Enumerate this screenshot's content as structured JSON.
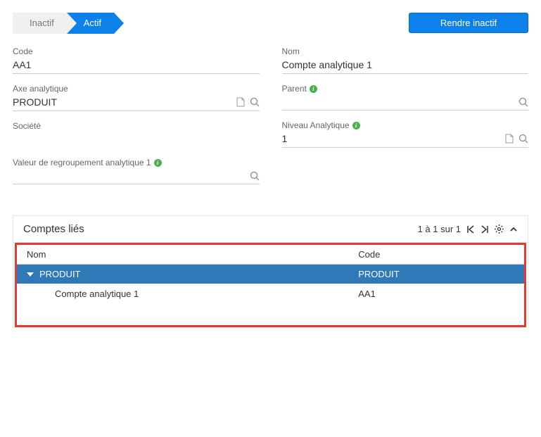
{
  "status": {
    "inactive": "Inactif",
    "active": "Actif"
  },
  "actions": {
    "make_inactive": "Rendre inactif"
  },
  "fields": {
    "code": {
      "label": "Code",
      "value": "AA1"
    },
    "nom": {
      "label": "Nom",
      "value": "Compte analytique 1"
    },
    "axe": {
      "label": "Axe analytique",
      "value": "PRODUIT"
    },
    "parent": {
      "label": "Parent",
      "value": ""
    },
    "societe": {
      "label": "Société",
      "value": ""
    },
    "niveau": {
      "label": "Niveau Analytique",
      "value": "1"
    },
    "regroup": {
      "label": "Valeur de regroupement analytique 1",
      "value": ""
    }
  },
  "panel": {
    "title": "Comptes liés",
    "pager": "1 à 1 sur 1",
    "columns": {
      "nom": "Nom",
      "code": "Code"
    },
    "group": {
      "nom": "PRODUIT",
      "code": "PRODUIT"
    },
    "row": {
      "nom": "Compte analytique 1",
      "code": "AA1"
    }
  }
}
